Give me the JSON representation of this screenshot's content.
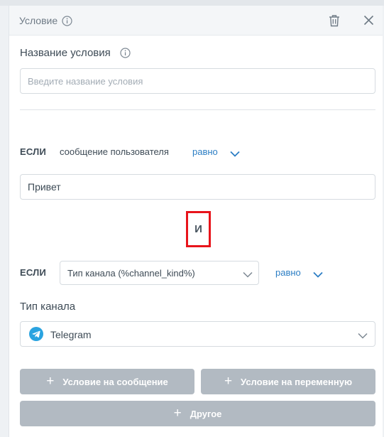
{
  "header": {
    "title": "Условие"
  },
  "name_section": {
    "label": "Название условия",
    "placeholder": "Введите название условия",
    "value": ""
  },
  "condition1": {
    "if_label": "ЕСЛИ",
    "subject": "сообщение пользователя",
    "operator": "равно",
    "value": "Привет"
  },
  "connector": {
    "label": "И"
  },
  "condition2": {
    "if_label": "ЕСЛИ",
    "subject": "Тип канала (%channel_kind%)",
    "operator": "равно"
  },
  "channel_type": {
    "label": "Тип канала",
    "selected": "Telegram"
  },
  "buttons": {
    "message_condition": "Условие на сообщение",
    "variable_condition": "Условие на переменную",
    "other": "Другое"
  },
  "colors": {
    "accent": "#2c7ec4",
    "highlight": "#e8141b",
    "button_bg": "#b2bac2",
    "telegram": "#2aa3e0"
  }
}
